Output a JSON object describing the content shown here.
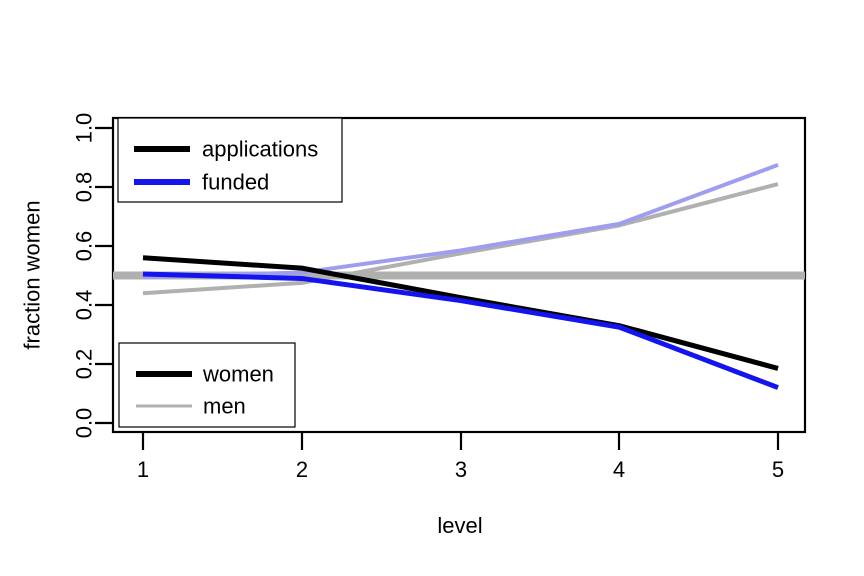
{
  "chart_data": {
    "type": "line",
    "title": "",
    "xlabel": "level",
    "ylabel": "fraction women",
    "xlim": [
      1,
      5
    ],
    "ylim": [
      0.0,
      1.0
    ],
    "grid": false,
    "x": [
      1,
      2,
      3,
      4,
      5
    ],
    "xticklabels": [
      "1",
      "2",
      "3",
      "4",
      "5"
    ],
    "yticks": [
      0.0,
      0.2,
      0.4,
      0.6,
      0.8,
      1.0
    ],
    "yticklabels": [
      "0.0",
      "0.2",
      "0.4",
      "0.6",
      "0.8",
      "1.0"
    ],
    "series": [
      {
        "name": "applications women",
        "group": "women",
        "measure": "applications",
        "color": "#000000",
        "width": 5,
        "values": [
          0.56,
          0.525,
          0.425,
          0.33,
          0.185
        ]
      },
      {
        "name": "funded women",
        "group": "women",
        "measure": "funded",
        "color": "#1414ef",
        "width": 5,
        "values": [
          0.505,
          0.49,
          0.415,
          0.325,
          0.12
        ]
      },
      {
        "name": "applications men",
        "group": "men",
        "measure": "applications",
        "color": "#b0b0b0",
        "width": 4,
        "values": [
          0.44,
          0.475,
          0.575,
          0.67,
          0.81
        ]
      },
      {
        "name": "funded men",
        "group": "men",
        "measure": "funded",
        "color": "#9e9ef0",
        "width": 4,
        "values": [
          0.495,
          0.51,
          0.585,
          0.675,
          0.875
        ]
      }
    ],
    "reference_line": {
      "name": "parity-line",
      "y": 0.5,
      "color": "#b0b0b0",
      "width": 8
    },
    "legends": [
      {
        "name": "measure-legend",
        "position": "topleft",
        "entries": [
          {
            "label": "applications",
            "color": "#000000",
            "width": 6
          },
          {
            "label": "funded",
            "color": "#1414ef",
            "width": 6
          }
        ]
      },
      {
        "name": "group-legend",
        "position": "bottomleft",
        "entries": [
          {
            "label": "women",
            "color": "#000000",
            "width": 6
          },
          {
            "label": "men",
            "color": "#b0b0b0",
            "width": 3
          }
        ]
      }
    ]
  }
}
